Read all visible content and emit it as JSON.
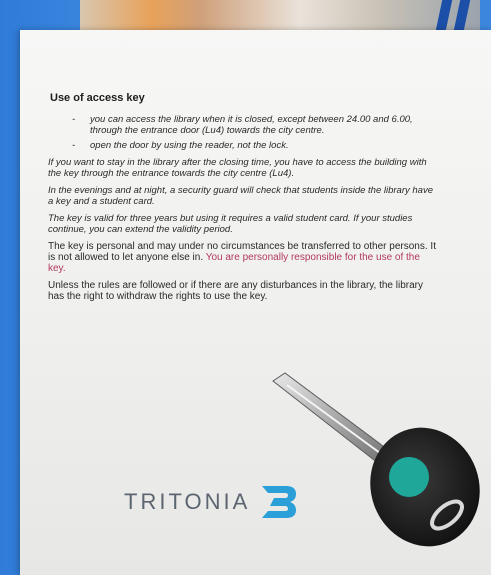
{
  "document": {
    "title": "Use of access key",
    "bullets": [
      "you can access the library when it is closed, except between 24.00 and 6.00, through the entrance door (Lu4) towards the city centre.",
      "open the door by using the reader, not the lock."
    ],
    "paragraphs": [
      "If you want to stay in the library after the closing time, you have to access the building with the key through the entrance towards the city centre (Lu4).",
      "In the evenings and at night, a security guard will check that students inside the library have a key and a student card.",
      "The key is valid for three years but using it requires a valid student card. If your studies continue, you can extend the validity period."
    ],
    "personal_text": "The key is personal and may under no circumstances be transferred to other persons. It is not allowed to let anyone else in.",
    "personal_highlight": "You are personally responsible for the use of the key.",
    "final_paragraph": "Unless the rules are followed or if there are any disturbances in the library, the library has the right to withdraw the rights to use the key."
  },
  "brand": {
    "name": "TRITONIA",
    "accent_color": "#2a9fd8",
    "key_button_color": "#1fa89a"
  },
  "colors": {
    "highlight_red": "#b23a5c",
    "background_blue": "#3a86dc"
  },
  "icons": {
    "logo": "tritonia-logo-icon",
    "key": "access-key-fob-icon"
  }
}
